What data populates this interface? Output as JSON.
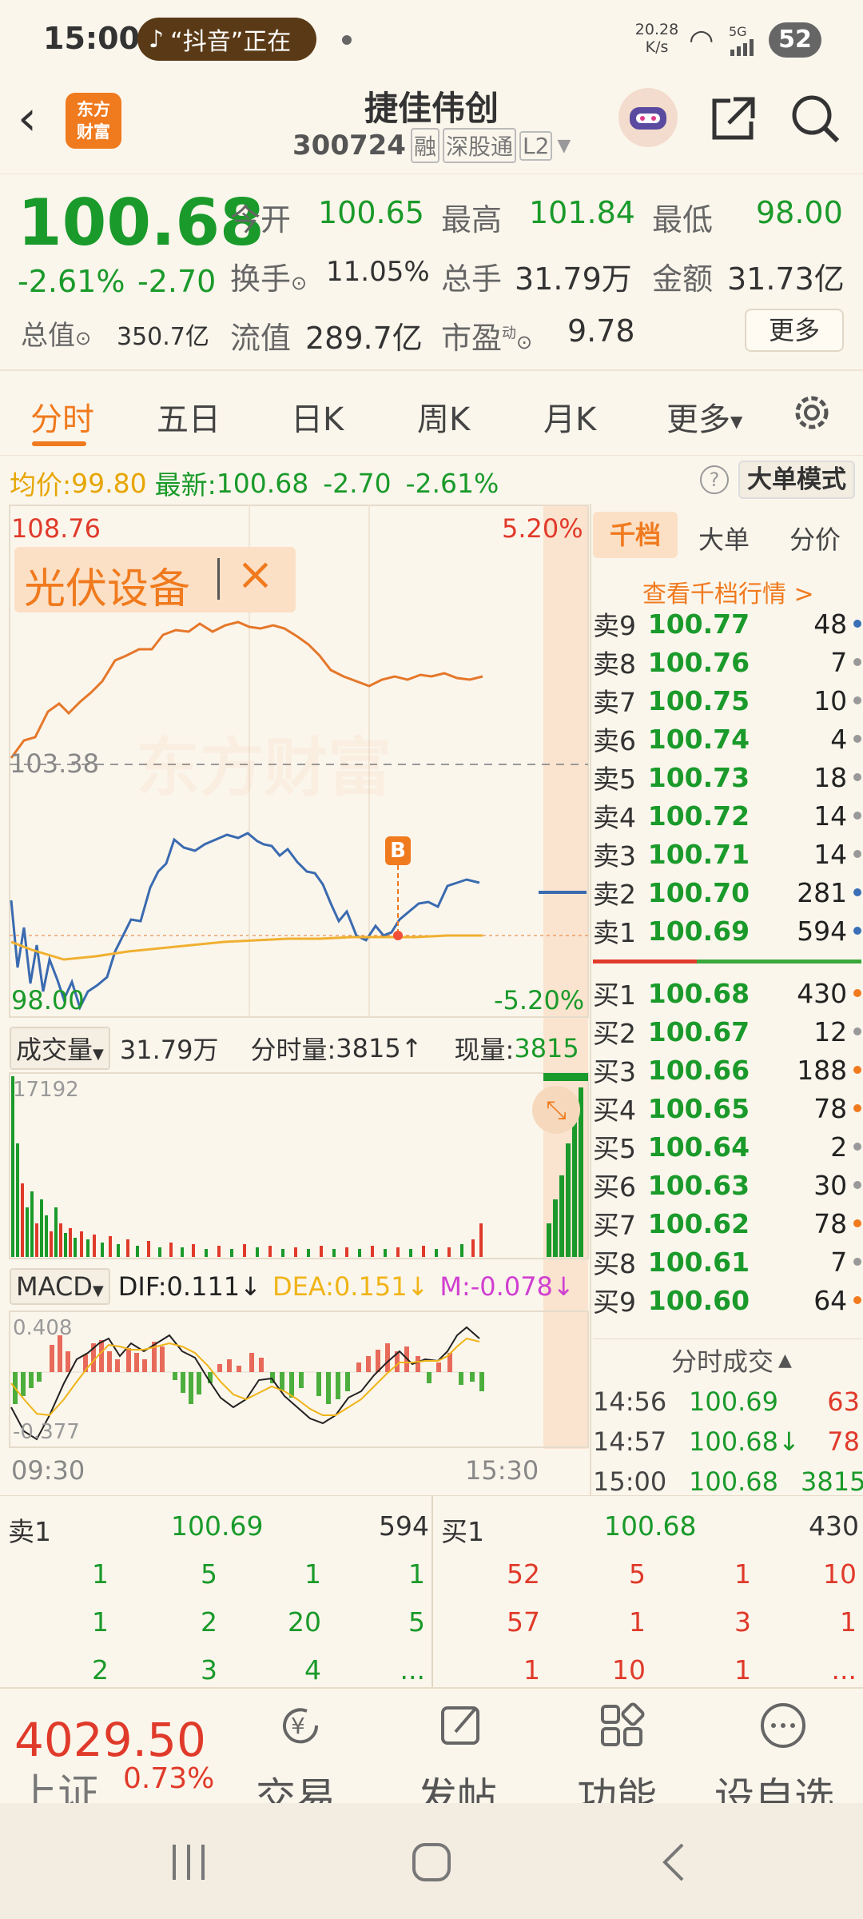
{
  "status": {
    "time": "15:00",
    "app_notice": "“抖音”正在",
    "net_speed_top": "20.28",
    "net_speed_unit": "K/s",
    "signal": "5G",
    "battery": "52"
  },
  "header": {
    "logo_line1": "东方",
    "logo_line2": "财富",
    "stock_name": "捷佳伟创",
    "code": "300724",
    "badges": [
      "融",
      "深股通",
      "L2"
    ]
  },
  "quote": {
    "price": "100.68",
    "change_pct": "-2.61%",
    "change": "-2.70",
    "open_label": "今开",
    "open": "100.65",
    "high_label": "最高",
    "high": "101.84",
    "low_label": "最低",
    "low": "98.00",
    "turnover_label": "换手",
    "turnover": "11.05%",
    "volume_label": "总手",
    "volume": "31.79万",
    "amount_label": "金额",
    "amount": "31.73亿",
    "mktcap_label": "总值",
    "mktcap": "350.7亿",
    "float_label": "流值",
    "float": "289.7亿",
    "pe_label": "市盈",
    "pe_sup": "动",
    "pe": "9.78",
    "more": "更多"
  },
  "tabs": [
    "分时",
    "五日",
    "日K",
    "周K",
    "月K",
    "更多"
  ],
  "avg": {
    "avg_label": "均价:",
    "avg": "99.80",
    "latest_label": "最新:",
    "latest": "100.68",
    "chg": "-2.70",
    "pct": "-2.61%",
    "mode": "大单模式"
  },
  "chart": {
    "top_price": "108.76",
    "top_pct": "5.20%",
    "mid_price": "103.38",
    "bottom_price": "98.00",
    "bottom_pct": "-5.20%",
    "overlay": "光伏设备",
    "watermark": "东方财富",
    "marker": "B",
    "vol_label": "成交量",
    "vol_total": "31.79万",
    "vol_tick_label": "分时量:",
    "vol_tick": "3815↑",
    "vol_now_label": "现量:",
    "vol_now": "3815",
    "vol_max": "17192",
    "macd": "MACD",
    "dif": "DIF:0.111↓",
    "dea": "DEA:0.151↓",
    "m": "M:-0.078↓",
    "macd_max": "0.408",
    "macd_min": "-0.377",
    "time_start": "09:30",
    "time_end": "15:30"
  },
  "right_tabs": [
    "千档",
    "大单",
    "分价"
  ],
  "right_link": "查看千档行情 >",
  "sell": [
    {
      "l": "卖9",
      "p": "100.77",
      "v": "48",
      "c": "#3b6fb6"
    },
    {
      "l": "卖8",
      "p": "100.76",
      "v": "7",
      "c": "#999999"
    },
    {
      "l": "卖7",
      "p": "100.75",
      "v": "10",
      "c": "#999999"
    },
    {
      "l": "卖6",
      "p": "100.74",
      "v": "4",
      "c": "#999999"
    },
    {
      "l": "卖5",
      "p": "100.73",
      "v": "18",
      "c": "#999999"
    },
    {
      "l": "卖4",
      "p": "100.72",
      "v": "14",
      "c": "#999999"
    },
    {
      "l": "卖3",
      "p": "100.71",
      "v": "14",
      "c": "#999999"
    },
    {
      "l": "卖2",
      "p": "100.70",
      "v": "281",
      "c": "#3b6fb6"
    },
    {
      "l": "卖1",
      "p": "100.69",
      "v": "594",
      "c": "#3b6fb6"
    }
  ],
  "buy": [
    {
      "l": "买1",
      "p": "100.68",
      "v": "430",
      "c": "#f07a1e"
    },
    {
      "l": "买2",
      "p": "100.67",
      "v": "12",
      "c": "#999999"
    },
    {
      "l": "买3",
      "p": "100.66",
      "v": "188",
      "c": "#f07a1e"
    },
    {
      "l": "买4",
      "p": "100.65",
      "v": "78",
      "c": "#f07a1e"
    },
    {
      "l": "买5",
      "p": "100.64",
      "v": "2",
      "c": "#999999"
    },
    {
      "l": "买6",
      "p": "100.63",
      "v": "30",
      "c": "#999999"
    },
    {
      "l": "买7",
      "p": "100.62",
      "v": "78",
      "c": "#f07a1e"
    },
    {
      "l": "买8",
      "p": "100.61",
      "v": "7",
      "c": "#999999"
    },
    {
      "l": "买9",
      "p": "100.60",
      "v": "64",
      "c": "#f07a1e"
    }
  ],
  "trades_title": "分时成交",
  "trades": [
    {
      "t": "14:56",
      "p": "100.69",
      "v": "63"
    },
    {
      "t": "14:57",
      "p": "100.68↓",
      "v": "78"
    },
    {
      "t": "15:00",
      "p": "100.68",
      "v": "3815"
    }
  ],
  "bottom": {
    "sell1_label": "卖1",
    "sell1_price": "100.69",
    "sell1_vol": "594",
    "buy1_label": "买1",
    "buy1_price": "100.68",
    "buy1_vol": "430",
    "left_rows": [
      [
        "1",
        "5",
        "1",
        "1"
      ],
      [
        "1",
        "2",
        "20",
        "5"
      ],
      [
        "2",
        "3",
        "4",
        "..."
      ]
    ],
    "right_rows": [
      [
        "52",
        "5",
        "1",
        "10"
      ],
      [
        "57",
        "1",
        "3",
        "1"
      ],
      [
        "1",
        "10",
        "1",
        "..."
      ]
    ]
  },
  "tabbar": {
    "index_value": "4029.50",
    "index_name": "上证",
    "index_pct": "0.73%",
    "items": [
      "交易",
      "发帖",
      "功能",
      "设自选"
    ]
  }
}
